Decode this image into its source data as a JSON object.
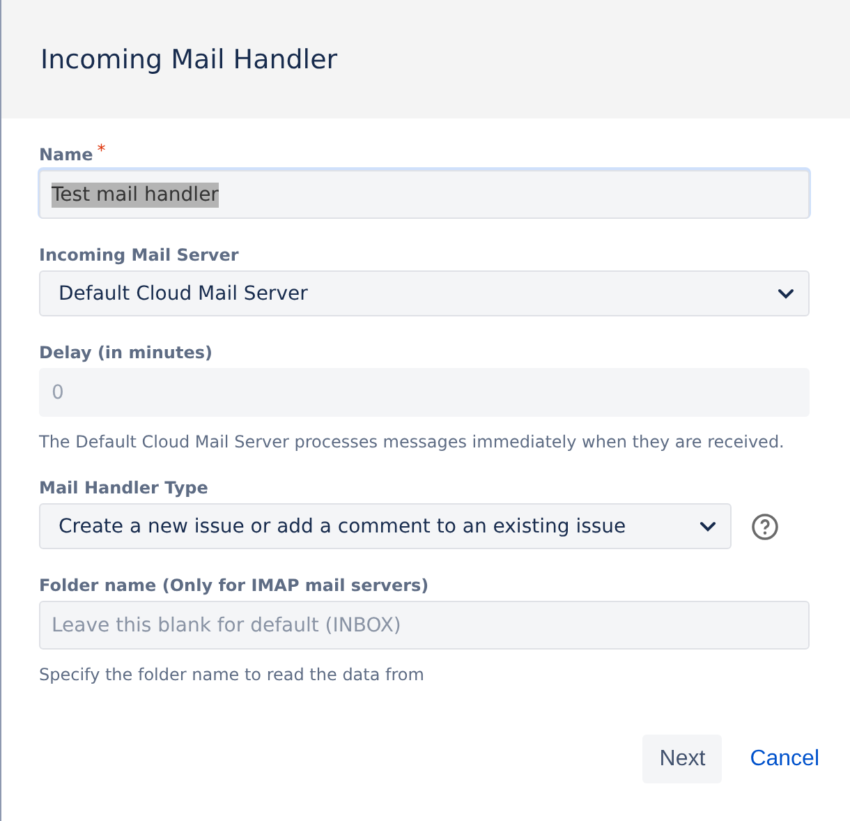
{
  "dialog": {
    "title": "Incoming Mail Handler"
  },
  "fields": [
    {
      "kind": "text",
      "label": "Name",
      "required_mark": "*",
      "value": "Test mail handler",
      "highlighted": true,
      "disabled": false,
      "focused": true
    },
    {
      "kind": "select",
      "label": "Incoming Mail Server",
      "value": "Default Cloud Mail Server",
      "disabled": false
    },
    {
      "kind": "text",
      "label": "Delay (in minutes)",
      "placeholder": "0",
      "disabled": true,
      "help": "The Default Cloud Mail Server processes messages immediately when they are received."
    },
    {
      "kind": "select",
      "label": "Mail Handler Type",
      "value": "Create a new issue or add a comment to an existing issue",
      "disabled": false,
      "help_icon": true
    },
    {
      "kind": "text",
      "label": "Folder name (Only for IMAP mail servers)",
      "placeholder": "Leave this blank for default (INBOX)",
      "disabled": false,
      "help": "Specify the folder name to read the data from"
    }
  ],
  "buttons": [
    {
      "label": "Next",
      "kind": "primary"
    },
    {
      "label": "Cancel",
      "kind": "link"
    }
  ]
}
